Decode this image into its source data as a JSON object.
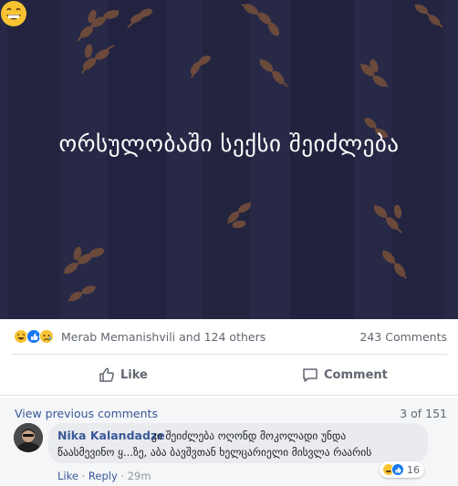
{
  "post": {
    "text": "ორსულობაში სექსი შეიძლება",
    "emoji": "grinning-face"
  },
  "reactions": {
    "icons": [
      "laugh-icon",
      "like-icon",
      "sad-icon"
    ],
    "names_text": "Merab Memanishvili and 124 others",
    "comments_text": "243 Comments"
  },
  "actions": {
    "like_label": "Like",
    "comment_label": "Comment"
  },
  "comments": {
    "view_previous": "View previous comments",
    "page_count": "3 of 151",
    "items": [
      {
        "author": "Nika Kalandadze",
        "text_line1": "კი შეიძლება ოღონდ მოკოლადი უნდა",
        "text_line2": "წაასმევინო ყ...ზე, აბა ბავშვთან ხელცარიელი მისვლა რაარის",
        "reaction_count": "16",
        "like_label": "Like",
        "reply_label": "Reply",
        "time": "29m"
      }
    ]
  },
  "colors": {
    "image_bg": "#262845",
    "link": "#385898",
    "muted": "#606770"
  }
}
